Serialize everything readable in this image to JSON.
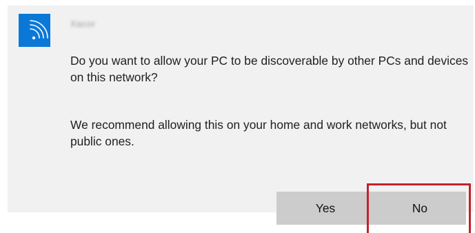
{
  "dialog": {
    "network_name": "Xacor",
    "message_1": "Do you want to allow your PC to be discoverable by other PCs and devices on this network?",
    "message_2": "We recommend allowing this on your home and work networks, but not public ones.",
    "icon": "wifi-icon",
    "accent_color": "#0b78d7",
    "highlight_color": "#c4202a"
  },
  "buttons": {
    "yes_label": "Yes",
    "no_label": "No"
  }
}
